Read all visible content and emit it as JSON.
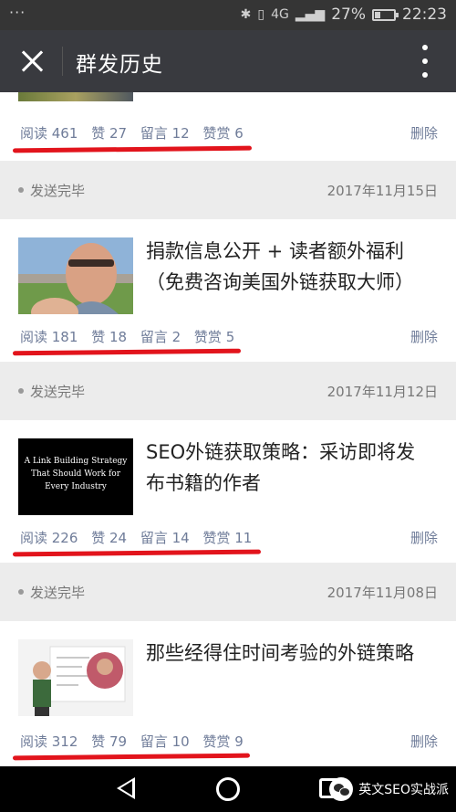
{
  "status_bar": {
    "dots": "···",
    "network": "4G",
    "battery_text": "27%",
    "battery_level": 0.27,
    "time": "22:23"
  },
  "title_bar": {
    "title": "群发历史"
  },
  "articles": [
    {
      "status": "",
      "date": "",
      "headline": "",
      "stats": {
        "read": "阅读 461",
        "like": "赞 27",
        "comment": "留言 12",
        "reward": "赞赏 6"
      },
      "delete_label": "删除"
    },
    {
      "status": "发送完毕",
      "date": "2017年11月15日",
      "headline": "捐款信息公开 + 读者额外福利（免费咨询美国外链获取大师）",
      "stats": {
        "read": "阅读 181",
        "like": "赞 18",
        "comment": "留言 2",
        "reward": "赞赏 5"
      },
      "delete_label": "删除"
    },
    {
      "status": "发送完毕",
      "date": "2017年11月12日",
      "headline": "SEO外链获取策略：采访即将发布书籍的作者",
      "thumb_text": "A Link Building Strategy That Should Work for Every Industry",
      "stats": {
        "read": "阅读 226",
        "like": "赞 24",
        "comment": "留言 14",
        "reward": "赞赏 11"
      },
      "delete_label": "删除"
    },
    {
      "status": "发送完毕",
      "date": "2017年11月08日",
      "headline": "那些经得住时间考验的外链策略",
      "stats": {
        "read": "阅读 312",
        "like": "赞 79",
        "comment": "留言 10",
        "reward": "赞赏 9"
      },
      "delete_label": "删除"
    }
  ],
  "watermark": {
    "label": "英文SEO实战派"
  },
  "colors": {
    "stat_text": "#6f7c99",
    "underline": "#e2141c",
    "title_bar": "#393a3f"
  }
}
